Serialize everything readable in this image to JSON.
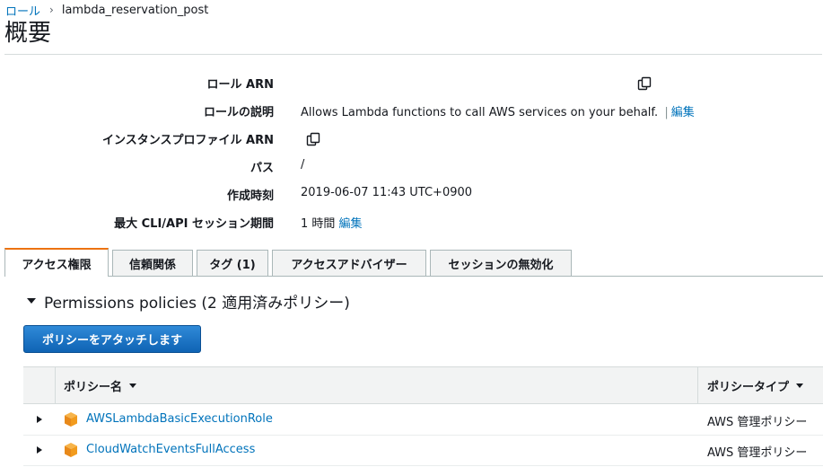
{
  "breadcrumb": {
    "parent": "ロール",
    "separator": "›",
    "current": "lambda_reservation_post"
  },
  "page_title": "概要",
  "summary": {
    "role_arn_label": "ロール ARN",
    "description_label": "ロールの説明",
    "description_value": "Allows Lambda functions to call AWS services on your behalf.",
    "description_separator": "|",
    "edit_label": "編集",
    "instance_profile_label": "インスタンスプロファイル ARN",
    "path_label": "パス",
    "path_value": "/",
    "created_label": "作成時刻",
    "created_value": "2019-06-07 11:43 UTC+0900",
    "max_session_label": "最大 CLI/API セッション期間",
    "max_session_value": "1 時間",
    "max_session_edit": "編集"
  },
  "tabs": [
    {
      "label": "アクセス権限",
      "active": true
    },
    {
      "label": "信頼関係",
      "active": false
    },
    {
      "label": "タグ (1)",
      "active": false
    },
    {
      "label": "アクセスアドバイザー",
      "active": false
    },
    {
      "label": "セッションの無効化",
      "active": false
    }
  ],
  "permissions": {
    "section_title": "Permissions policies (2 適用済みポリシー)",
    "attach_button": "ポリシーをアタッチします",
    "columns": {
      "name": "ポリシー名",
      "type": "ポリシータイプ"
    },
    "rows": [
      {
        "name": "AWSLambdaBasicExecutionRole",
        "type": "AWS 管理ポリシー"
      },
      {
        "name": "CloudWatchEventsFullAccess",
        "type": "AWS 管理ポリシー"
      }
    ]
  },
  "colors": {
    "link": "#0073bb",
    "accent_tab": "#ec7211",
    "button": "#0f63b4",
    "policy_icon": "#f29b1d"
  },
  "icons": {
    "copy": "copy-icon",
    "expand": "chevron-right-icon",
    "collapse": "caret-down-icon",
    "policy": "aws-policy-cube-icon",
    "sort": "sort-caret-icon"
  }
}
